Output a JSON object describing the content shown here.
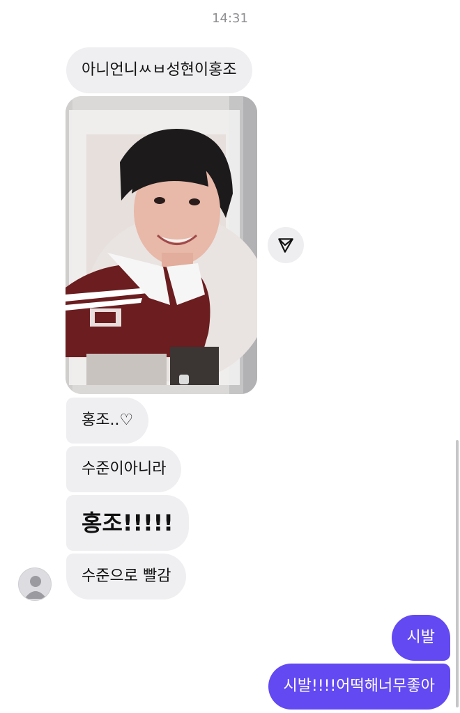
{
  "chat": {
    "timestamp": "14:31",
    "incoming": [
      "아니언니ㅆㅂ성현이홍조",
      "홍조..♡",
      "수준이아니라",
      "홍조!!!!!",
      "수준으로 빨감"
    ],
    "outgoing": [
      "시발",
      "시발!!!!어떡해너무좋아"
    ],
    "photo_icon": "photo-of-person-in-maroon-jersey",
    "share_icon": "paper-plane-share-icon",
    "avatar_icon": "default-user-avatar",
    "colors": {
      "incoming_bubble": "#efeff2",
      "outgoing_bubble": "#6249f2",
      "timestamp": "#8e8e93"
    }
  }
}
